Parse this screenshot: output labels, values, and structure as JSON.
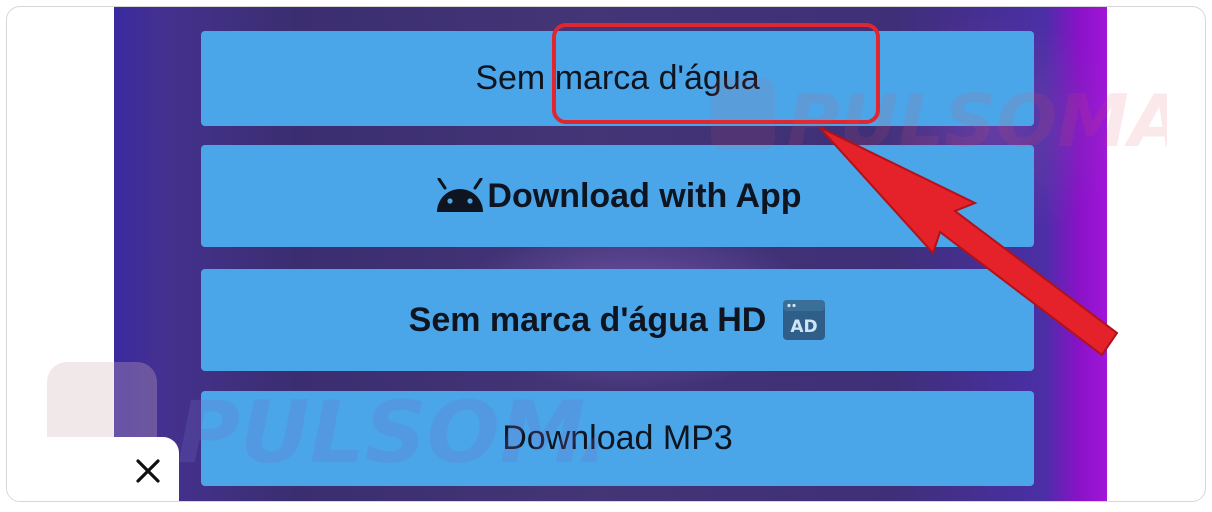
{
  "buttons": {
    "no_watermark": "Sem marca d'água",
    "download_app": "Download with App",
    "no_watermark_hd": "Sem marca d'água HD",
    "download_mp3": "Download MP3"
  },
  "ad_badge": "AD",
  "watermark": {
    "text": "PULSOMAX"
  },
  "colors": {
    "button_bg": "#4aa6e9",
    "highlight": "#e0262e",
    "arrow": "#e5212a",
    "panel_edge": "#a116d8"
  },
  "icons": [
    "android-icon",
    "ad-badge-icon",
    "close-icon",
    "red-arrow"
  ]
}
